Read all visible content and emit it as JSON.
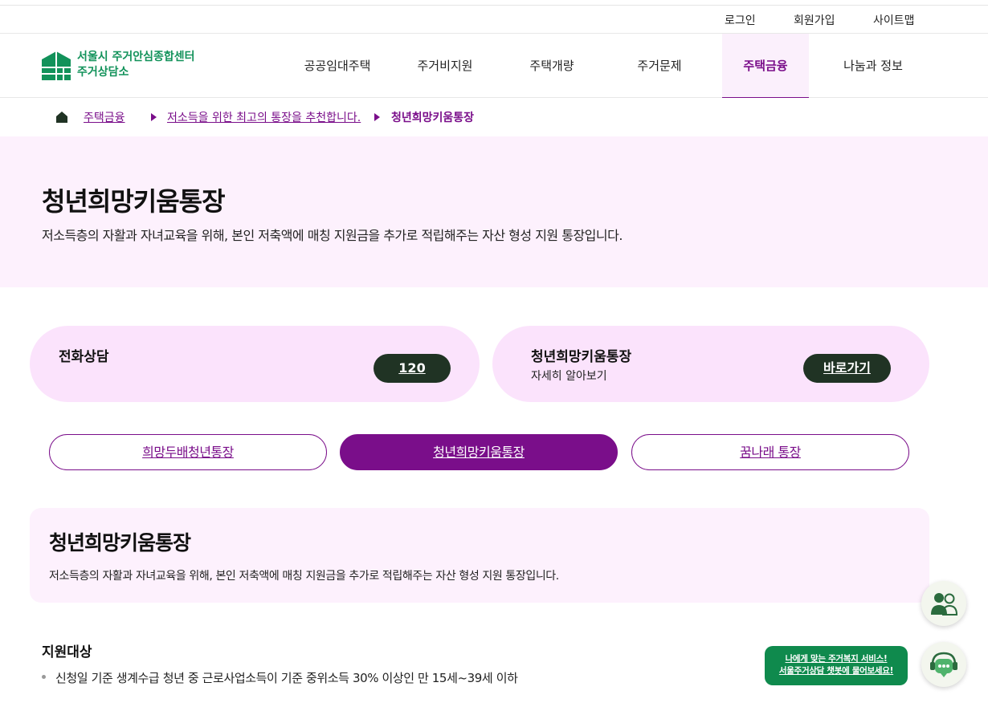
{
  "util_nav": {
    "login": "로그인",
    "signup": "회원가입",
    "sitemap": "사이트맵"
  },
  "logo": {
    "line1": "서울시 주거안심종합센터",
    "line2": "주거상담소",
    "color": "#12925a"
  },
  "nav": {
    "items": [
      {
        "label": "공공임대주택"
      },
      {
        "label": "주거비지원"
      },
      {
        "label": "주택개량"
      },
      {
        "label": "주거문제"
      },
      {
        "label": "주택금융"
      },
      {
        "label": "나눔과 정보"
      }
    ],
    "active_label": "주택금융"
  },
  "breadcrumb": {
    "level1": "주택금융",
    "level2": "저소득을 위한 최고의 통장을 추천합니다.",
    "current": "청년희망키움통장"
  },
  "hero": {
    "title": "청년희망키움통장",
    "description": "저소득층의 자활과 자녀교육을 위해, 본인 저축액에 매칭 지원금을 추가로 적립해주는 자산 형성 지원 통장입니다."
  },
  "quick_cards": {
    "phone": {
      "title": "전화상담",
      "button": "120"
    },
    "account": {
      "title": "청년희망키움통장",
      "subtitle": "자세히 알아보기",
      "button": "바로가기"
    }
  },
  "tabs": [
    {
      "label": "희망두배청년통장",
      "active": false
    },
    {
      "label": "청년희망키움통장",
      "active": true
    },
    {
      "label": "꿈나래 통장",
      "active": false
    }
  ],
  "info": {
    "title": "청년희망키움통장",
    "description": "저소득층의 자활과 자녀교육을 위해, 본인 저축액에 매칭 지원금을 추가로 적립해주는 자산 형성 지원 통장입니다."
  },
  "eligibility": {
    "title": "지원대상",
    "items": [
      "신청일 기준 생계수급 청년 중 근로사업소득이 기준 중위소득 30% 이상인 만 15세~39세 이하"
    ]
  },
  "floating": {
    "chat_banner_line1": "나에게 맞는 주거복지 서비스!",
    "chat_banner_line2": "서울주거상담 챗봇에 물어보세요!",
    "people_icon": "people-icon",
    "chatbot_icon": "chatbot-icon"
  },
  "colors": {
    "accent": "#7a0e8a",
    "hero_bg": "#fdf1fd",
    "card_bg": "#fbe3fc",
    "pill_bg": "#203324",
    "brand_green": "#0f8a4d"
  }
}
